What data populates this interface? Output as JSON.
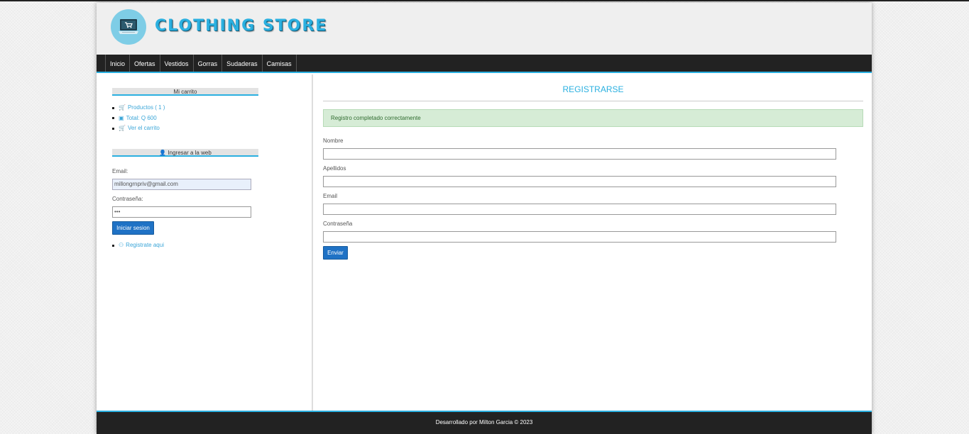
{
  "header": {
    "brand": "CLOTHING STORE",
    "logo_icon": "cart-laptop-icon"
  },
  "nav": [
    "Inicio",
    "Ofertas",
    "Vestidos",
    "Gorras",
    "Sudaderas",
    "Camisas"
  ],
  "sidebar": {
    "cart_title": "Mi carrito",
    "cart_items": [
      {
        "icon": "cart-icon",
        "label": "Productos ( 1 )"
      },
      {
        "icon": "money-icon",
        "label": "Total: Q 600"
      },
      {
        "icon": "cart-icon",
        "label": "Ver el carrito"
      }
    ],
    "login_title": "Ingresar a la web",
    "email_label": "Email:",
    "email_value": "millongrnpriv@gmail.com",
    "password_label": "Contraseña:",
    "password_value": "•••",
    "login_button": "Iniciar sesion",
    "register_link": "Registrate aqui"
  },
  "main": {
    "title": "REGISTRARSE",
    "alert": "Registro completado correctamente",
    "fields": [
      "Nombre",
      "Apellidos",
      "Email",
      "Contraseña"
    ],
    "submit": "Enviar"
  },
  "footer": {
    "text": "Desarrollado por Milton Garcia © 2023"
  },
  "colors": {
    "accent": "#2bb0e0",
    "nav_bg": "#222222",
    "button": "#1f72c5",
    "alert_bg": "#d6ecd6"
  }
}
